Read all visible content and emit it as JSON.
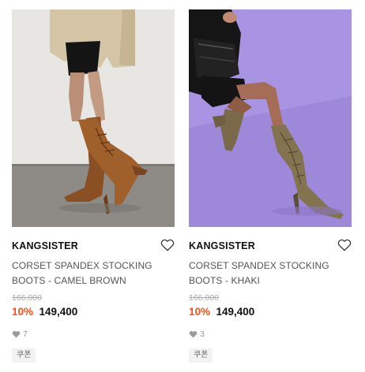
{
  "products": [
    {
      "image_alt": "Camel brown lace-up stocking boots",
      "brand": "KANGSISTER",
      "title": "CORSET SPANDEX STOCKING BOOTS - CAMEL BROWN",
      "original_price": "166,000",
      "discount": "10%",
      "price": "149,400",
      "likes": "7",
      "badge": "쿠폰",
      "wishlist_icon": "heart-outline-icon",
      "like_icon": "heart-filled-icon"
    },
    {
      "image_alt": "Khaki lace-up stocking boots on purple background",
      "brand": "KANGSISTER",
      "title": "CORSET SPANDEX STOCKING BOOTS - KHAKI",
      "original_price": "166,000",
      "discount": "10%",
      "price": "149,400",
      "likes": "3",
      "badge": "쿠폰",
      "wishlist_icon": "heart-outline-icon",
      "like_icon": "heart-filled-icon"
    }
  ],
  "colors": {
    "discount": "#ff4f1a",
    "price": "#111111",
    "muted": "#999999"
  }
}
